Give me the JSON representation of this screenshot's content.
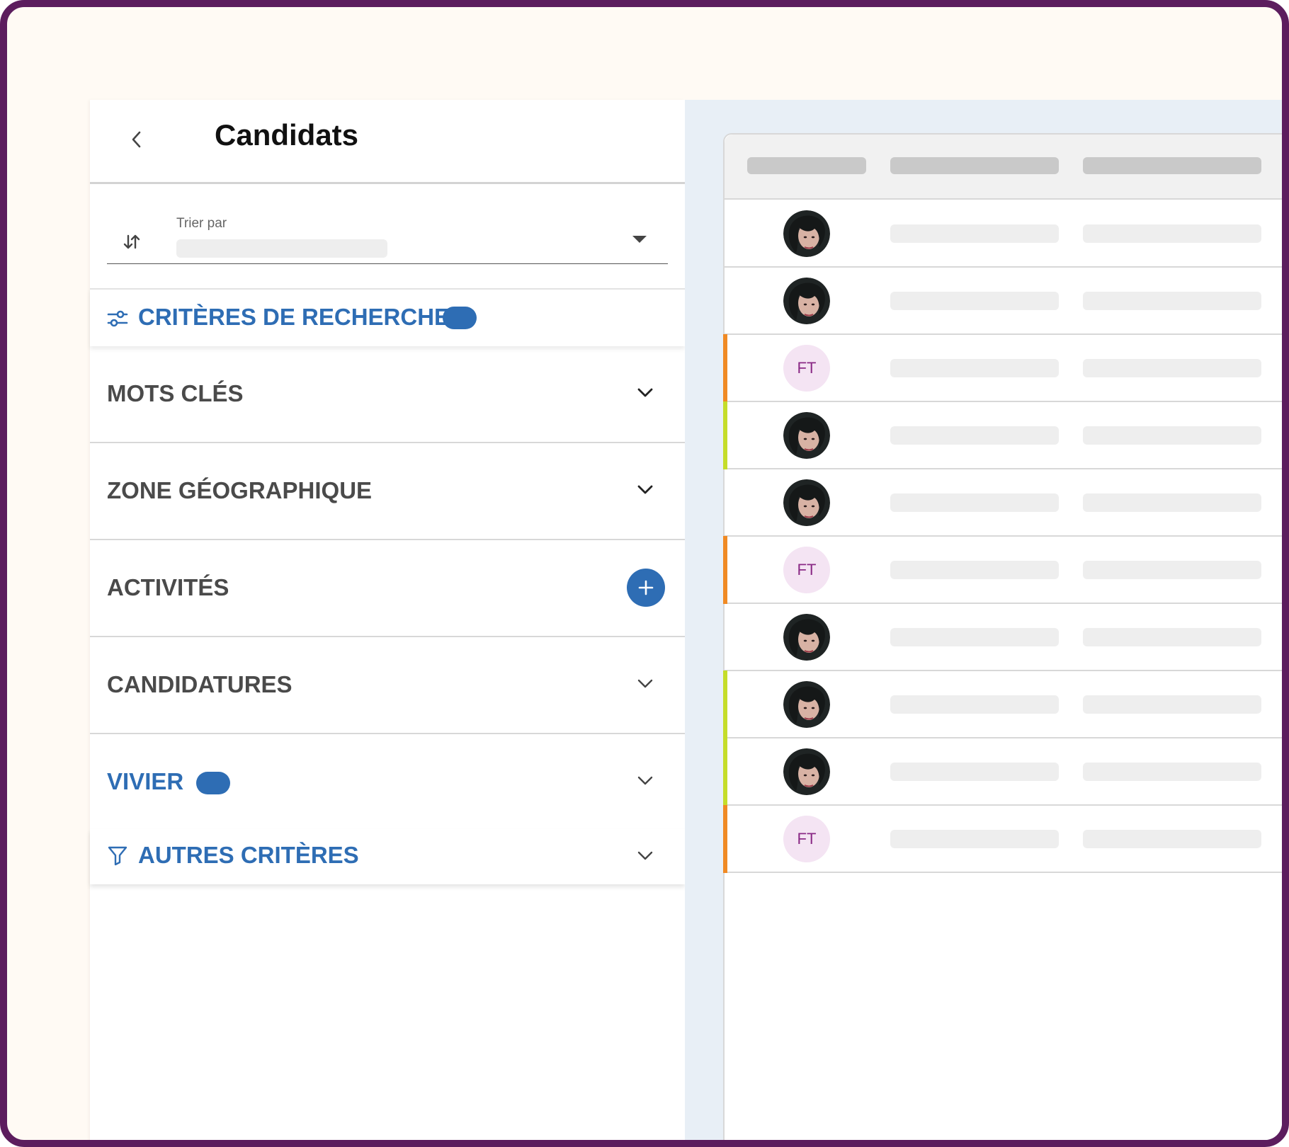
{
  "panel": {
    "title": "Candidats",
    "sort": {
      "label": "Trier par",
      "value": ""
    },
    "criteria_label": "CRITÈRES DE RECHERCHE",
    "sections": [
      {
        "label": "MOTS CLÉS",
        "control": "chevron-down-icon"
      },
      {
        "label": "ZONE GÉOGRAPHIQUE",
        "control": "chevron-down-icon"
      },
      {
        "label": "ACTIVITÉS",
        "control": "plus-icon"
      },
      {
        "label": "CANDIDATURES",
        "control": "chevron-down-icon"
      },
      {
        "label": "VIVIER",
        "control": "chevron-down-icon"
      }
    ],
    "other_criteria_label": "AUTRES CRITÈRES"
  },
  "table": {
    "rows": [
      {
        "avatar": "photo",
        "accent": null
      },
      {
        "avatar": "photo",
        "accent": null
      },
      {
        "avatar": "initials",
        "initials": "FT",
        "accent": "#f08a24"
      },
      {
        "avatar": "photo",
        "accent": "#c5dd2a"
      },
      {
        "avatar": "photo",
        "accent": null
      },
      {
        "avatar": "initials",
        "initials": "FT",
        "accent": "#f08a24"
      },
      {
        "avatar": "photo",
        "accent": null
      },
      {
        "avatar": "photo",
        "accent": "#c5dd2a"
      },
      {
        "avatar": "photo",
        "accent": "#c5dd2a"
      },
      {
        "avatar": "initials",
        "initials": "FT",
        "accent": "#f08a24"
      }
    ]
  },
  "colors": {
    "frame": "#5c1d5e",
    "primary": "#2e6db4",
    "initials_bg": "#f4e4f3",
    "initials_text": "#8a2a86"
  }
}
